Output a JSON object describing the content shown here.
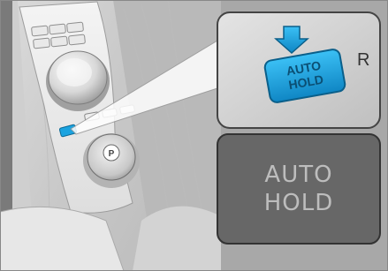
{
  "button": {
    "label_line1": "AUTO",
    "label_line2": "HOLD"
  },
  "gear_letter": "R",
  "park_letter": "P",
  "indicator_panel": {
    "line1": "AUTO",
    "line2": "HOLD"
  },
  "colors": {
    "accent_blue": "#1aa3e0",
    "panel_gray": "#676767",
    "panel_text": "#bdbdbd"
  }
}
